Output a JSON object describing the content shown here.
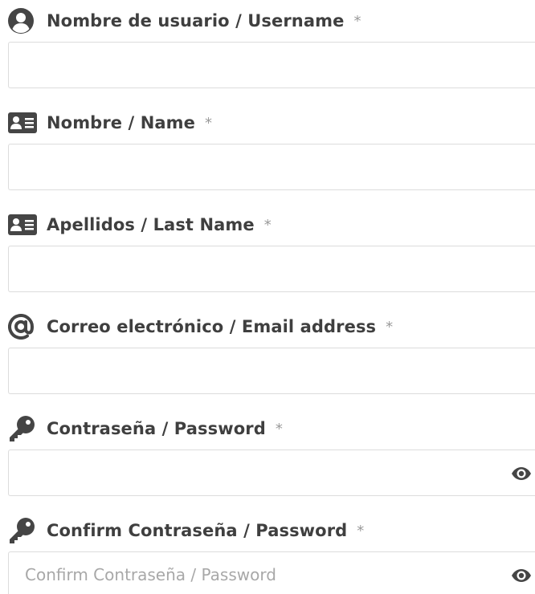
{
  "required_marker": "*",
  "fields": {
    "username": {
      "label": "Nombre de usuario / Username",
      "icon": "user-circle-icon",
      "placeholder": "",
      "value": ""
    },
    "name": {
      "label": "Nombre / Name",
      "icon": "id-card-icon",
      "placeholder": "",
      "value": ""
    },
    "last_name": {
      "label": "Apellidos / Last Name",
      "icon": "id-card-icon",
      "placeholder": "",
      "value": ""
    },
    "email": {
      "label": "Correo electrónico / Email address",
      "icon": "at-sign-icon",
      "placeholder": "",
      "value": ""
    },
    "password": {
      "label": "Contraseña / Password",
      "icon": "key-icon",
      "placeholder": "",
      "value": "",
      "toggle_icon": "eye-icon"
    },
    "confirm_password": {
      "label": "Confirm Contraseña / Password",
      "icon": "key-icon",
      "placeholder": "Confirm Contraseña / Password",
      "value": "",
      "toggle_icon": "eye-icon"
    }
  },
  "colors": {
    "label_text": "#3f3f3f",
    "icon": "#454545",
    "required_marker": "#9a9a9a",
    "input_border": "#dcdcdc",
    "placeholder": "#a8a8a8"
  }
}
